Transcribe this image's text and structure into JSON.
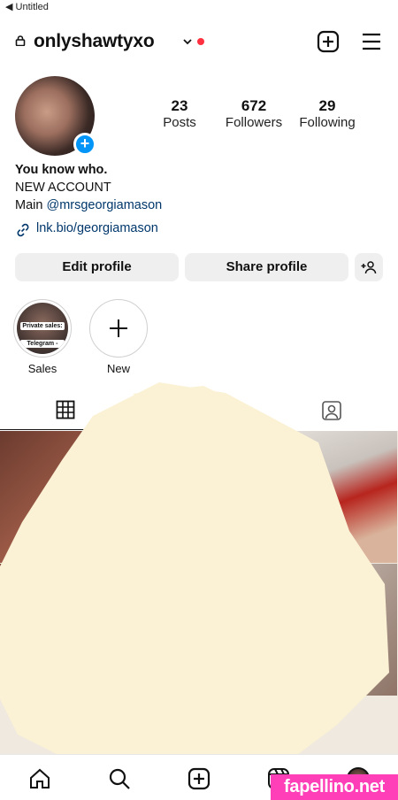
{
  "status_bar": {
    "back_label": "◀ Untitled"
  },
  "header": {
    "username": "onlyshawtyxo"
  },
  "stats": [
    {
      "value": "23",
      "label": "Posts"
    },
    {
      "value": "672",
      "label": "Followers"
    },
    {
      "value": "29",
      "label": "Following"
    }
  ],
  "bio": {
    "name": "You know who.",
    "line2": "NEW ACCOUNT",
    "line3_prefix": "Main",
    "mention": "@mrsgeorgiamason",
    "link": "lnk.bio/georgiamason"
  },
  "buttons": {
    "edit_profile": "Edit profile",
    "share_profile": "Share profile"
  },
  "highlights": [
    {
      "label": "Sales",
      "cover_line1": "Private sales:",
      "cover_line2": "Telegram -"
    },
    {
      "label": "New"
    }
  ],
  "colors": {
    "accent_blue": "#0095f6",
    "link_blue": "#00376b",
    "notification_red": "#ff3040",
    "redaction_cream": "#fbf2d5"
  },
  "watermark": "fapellino.net",
  "icons": {
    "top_bar": [
      "lock-icon",
      "chevron-down-icon",
      "new-post-icon",
      "menu-icon"
    ],
    "tabs": [
      "grid-icon",
      "tagged-icon"
    ],
    "bottom_nav": [
      "home-icon",
      "search-icon",
      "create-icon",
      "reels-icon"
    ]
  }
}
